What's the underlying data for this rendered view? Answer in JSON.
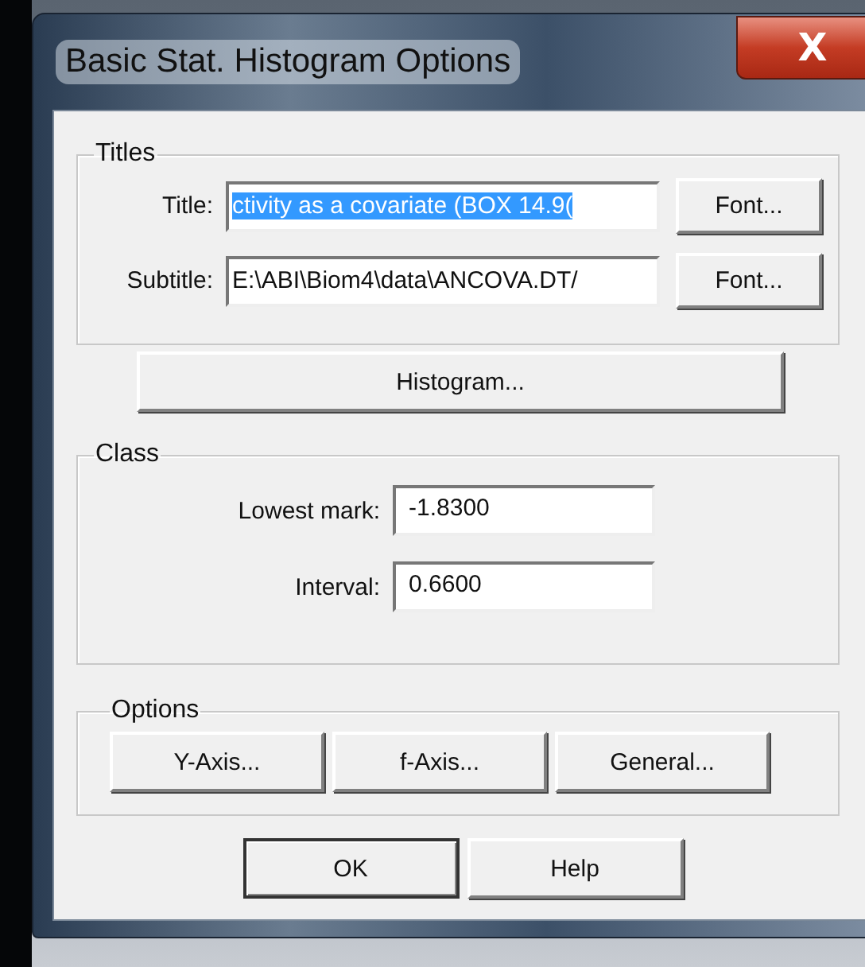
{
  "window": {
    "title": "Basic Stat. Histogram Options",
    "close": "X"
  },
  "titles_group": {
    "legend": "Titles",
    "rows": [
      {
        "label": "Title:",
        "value": "ctivity as a covariate (BOX 14.9(",
        "text_selected": true,
        "button": "Font..."
      },
      {
        "label": "Subtitle:",
        "value": "E:\\ABI\\Biom4\\data\\ANCOVA.DT/",
        "text_selected": false,
        "button": "Font..."
      }
    ]
  },
  "histogram_button": "Histogram...",
  "class_group": {
    "legend": "Class",
    "fields": [
      {
        "label": "Lowest mark:",
        "value": "-1.8300"
      },
      {
        "label": "Interval:",
        "value": "0.6600"
      }
    ]
  },
  "options_group": {
    "legend": "Options",
    "buttons": [
      "Y-Axis...",
      "f-Axis...",
      "General..."
    ]
  },
  "buttons": [
    {
      "label": "OK",
      "default": true
    },
    {
      "label": "Help",
      "default": false
    }
  ]
}
